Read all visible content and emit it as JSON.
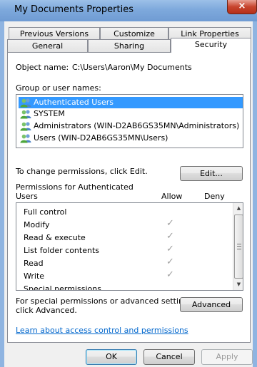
{
  "window": {
    "title": "My Documents Properties",
    "close_glyph": "×"
  },
  "tabs": {
    "row_back": [
      {
        "label": "Previous Versions"
      },
      {
        "label": "Customize"
      },
      {
        "label": "Link Properties"
      }
    ],
    "row_front": [
      {
        "label": "General"
      },
      {
        "label": "Sharing"
      },
      {
        "label": "Security",
        "active": true
      }
    ]
  },
  "security": {
    "object_name_label": "Object name:",
    "object_name_value": "C:\\Users\\Aaron\\My Documents",
    "group_label": "Group or user names:",
    "groups": [
      {
        "name": "Authenticated Users",
        "selected": true,
        "icon": "user-group-icon"
      },
      {
        "name": "SYSTEM",
        "selected": false,
        "icon": "user-group-icon"
      },
      {
        "name": "Administrators (WIN-D2AB6GS35MN\\Administrators)",
        "selected": false,
        "icon": "user-group-icon"
      },
      {
        "name": "Users (WIN-D2AB6GS35MN\\Users)",
        "selected": false,
        "icon": "user-group-icon"
      }
    ],
    "change_text": "To change permissions, click Edit.",
    "edit_button": "Edit...",
    "permissions_for_line1": "Permissions for Authenticated",
    "permissions_for_line2": "Users",
    "allow_header": "Allow",
    "deny_header": "Deny",
    "permissions": [
      {
        "name": "Full control",
        "allow": false,
        "deny": false
      },
      {
        "name": "Modify",
        "allow": true,
        "deny": false
      },
      {
        "name": "Read & execute",
        "allow": true,
        "deny": false
      },
      {
        "name": "List folder contents",
        "allow": true,
        "deny": false
      },
      {
        "name": "Read",
        "allow": true,
        "deny": false
      },
      {
        "name": "Write",
        "allow": true,
        "deny": false
      },
      {
        "name": "Special permissions",
        "allow": false,
        "deny": false
      }
    ],
    "check_glyph": "✓",
    "special_text_line1": "For special permissions or advanced settings,",
    "special_text_line2": "click Advanced.",
    "advanced_button": "Advanced",
    "learn_link": "Learn about access control and permissions"
  },
  "footer": {
    "ok": "OK",
    "cancel": "Cancel",
    "apply": "Apply"
  },
  "colors": {
    "selection": "#3399ff",
    "link": "#0066cc",
    "titlebar": "#7ea9dc"
  }
}
